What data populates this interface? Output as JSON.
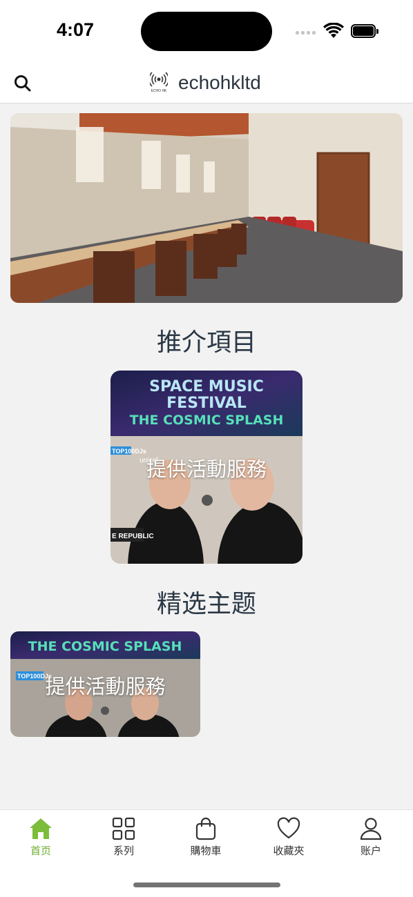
{
  "status_bar": {
    "time": "4:07"
  },
  "header": {
    "brand_name": "echohkltd",
    "logo_text": "ECHO HK"
  },
  "sections": {
    "recommended_title": "推介項目",
    "featured_title": "精选主题"
  },
  "cards": {
    "recommended_label": "提供活動服務",
    "featured_label": "提供活動服務",
    "poster_line1": "SPACE MUSIC",
    "poster_line2": "FESTIVAL",
    "poster_line3": "THE COSMIC SPLASH",
    "poster_badge": "TOP100DJs",
    "poster_sponsor": "unicef",
    "poster_caption": "E REPUBLIC"
  },
  "tabbar": {
    "items": [
      {
        "label": "首页",
        "icon": "home-icon",
        "active": true
      },
      {
        "label": "系列",
        "icon": "grid-icon",
        "active": false
      },
      {
        "label": "購物車",
        "icon": "bag-icon",
        "active": false
      },
      {
        "label": "收藏夾",
        "icon": "heart-icon",
        "active": false
      },
      {
        "label": "账户",
        "icon": "user-icon",
        "active": false
      }
    ]
  },
  "colors": {
    "accent": "#6fae2e",
    "title_text": "#2a3745",
    "background": "#f2f2f2"
  }
}
